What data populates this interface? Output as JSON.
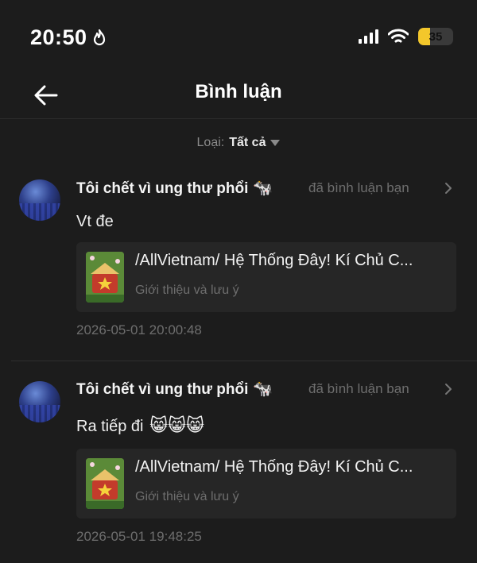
{
  "status_bar": {
    "time": "20:50",
    "battery": "35",
    "battery_level": 0.35,
    "battery_color": "#f3c72b"
  },
  "nav": {
    "title": "Bình luận"
  },
  "filter": {
    "label": "Loại:",
    "value": "Tất cả"
  },
  "comments": [
    {
      "username": "Tôi chết vì ung thư phổi",
      "user_emoji": "🐄",
      "action": "đã bình luận bạn",
      "text": "Vt đe",
      "emojis": "",
      "story_title": "/AllVietnam/ Hệ Thống Đây! Kí Chủ C...",
      "story_subtitle": "Giới thiệu và lưu ý",
      "timestamp": "2026-05-01 20:00:48"
    },
    {
      "username": "Tôi chết vì ung thư phổi",
      "user_emoji": "🐄",
      "action": "đã bình luận bạn",
      "text": "Ra tiếp đi",
      "emojis": "😸😸😸",
      "story_title": "/AllVietnam/ Hệ Thống Đây! Kí Chủ C...",
      "story_subtitle": "Giới thiệu và lưu ý",
      "timestamp": "2026-05-01 19:48:25"
    }
  ]
}
